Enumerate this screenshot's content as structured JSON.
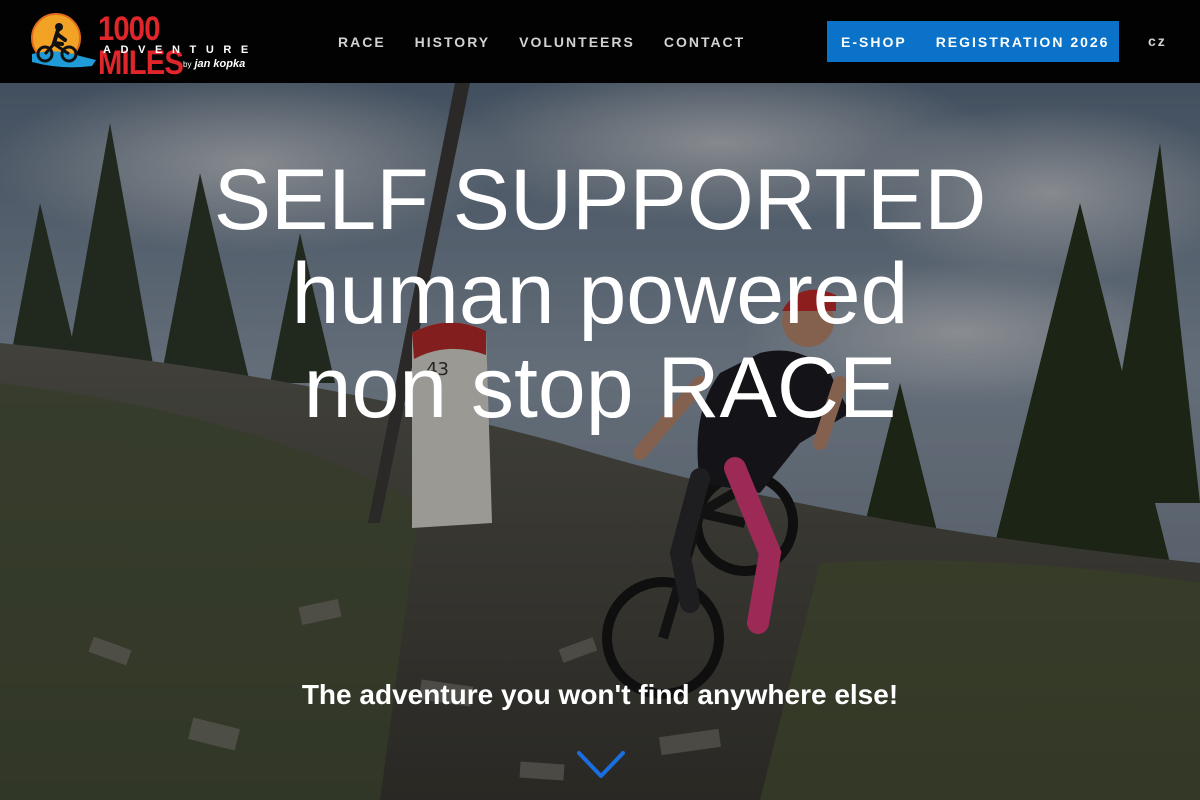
{
  "logo": {
    "wordmark": "1000 MILES",
    "subtitle": "ADVENTURE",
    "by": "by",
    "author": "jan kopka"
  },
  "nav": {
    "items": [
      {
        "label": "RACE"
      },
      {
        "label": "HISTORY"
      },
      {
        "label": "VOLUNTEERS"
      },
      {
        "label": "CONTACT"
      }
    ]
  },
  "cta": {
    "eshop": "E-SHOP",
    "registration": "REGISTRATION 2026"
  },
  "lang": "cz",
  "hero": {
    "headline": [
      "SELF SUPPORTED",
      "human powered",
      "non stop RACE"
    ],
    "tagline": "The adventure you won't find anywhere else!",
    "milestone_marker": "43"
  },
  "colors": {
    "header_bg": "#020202",
    "accent_blue": "#0a72c8",
    "logo_red": "#e0262a",
    "nav_text": "#d2d2d2"
  },
  "icons": {
    "scroll": "chevron-down-icon",
    "logo": "cyclist-sun-icon"
  }
}
